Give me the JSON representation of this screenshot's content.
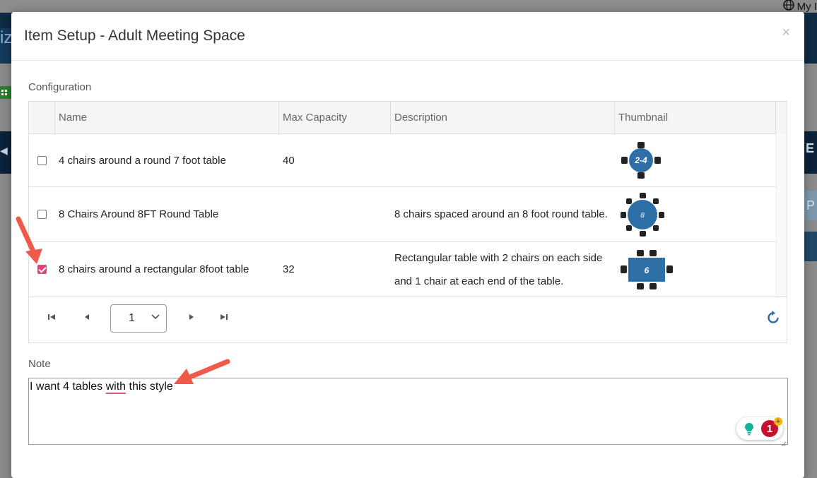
{
  "background": {
    "top_link": "My I",
    "right_letter": "E",
    "right_btn_letter": "P",
    "left_fragment": "iz"
  },
  "modal": {
    "title": "Item Setup - Adult Meeting Space",
    "close_label": "×"
  },
  "configuration": {
    "label": "Configuration",
    "columns": [
      "Name",
      "Max Capacity",
      "Description",
      "Thumbnail"
    ],
    "rows": [
      {
        "checked": false,
        "name": "4 chairs around a round 7 foot table",
        "max_capacity": "40",
        "description": "",
        "thumbnail_label": "2-4",
        "thumbnail_icon": "round-table-4-chairs-icon"
      },
      {
        "checked": false,
        "name": "8 Chairs Around 8FT Round Table",
        "max_capacity": "",
        "description": "8 chairs spaced around an 8 foot round table.",
        "thumbnail_label": "8",
        "thumbnail_icon": "round-table-8-chairs-icon"
      },
      {
        "checked": true,
        "name": "8 chairs around a rectangular 8foot table",
        "max_capacity": "32",
        "description": "Rectangular table with 2 chairs on each side and 1 chair at each end of the table.",
        "thumbnail_label": "6",
        "thumbnail_icon": "rect-table-chairs-icon"
      }
    ],
    "pager": {
      "page": "1"
    }
  },
  "note": {
    "label": "Note",
    "value_before": "I want 4 tables ",
    "value_underlined": "with",
    "value_after": " this style"
  },
  "grammar": {
    "count": "1",
    "plus": "+"
  },
  "colors": {
    "accent": "#e8407a",
    "table_blue": "#2f6fa8",
    "arrow": "#ef5a4a",
    "refresh": "#2f6fa8"
  }
}
